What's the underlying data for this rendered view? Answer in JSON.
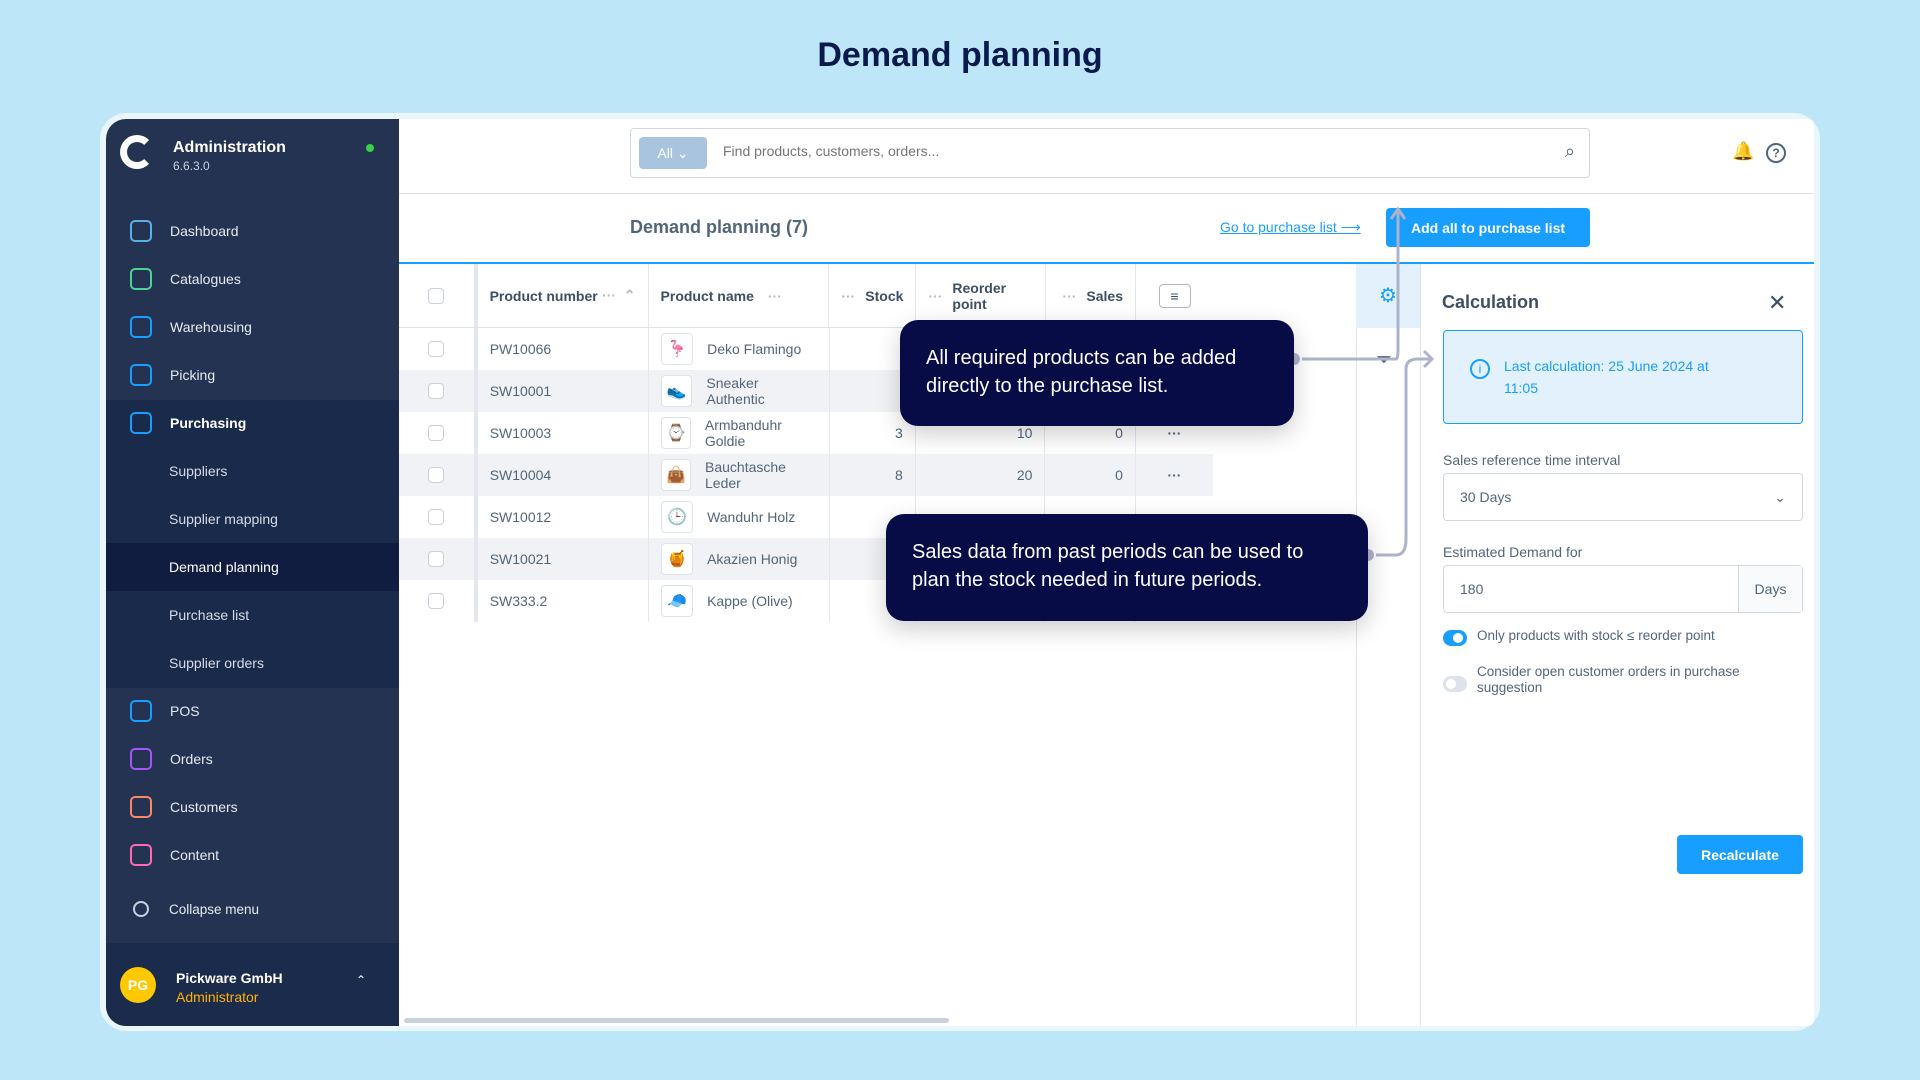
{
  "page_title": "Demand planning",
  "sidebar": {
    "app_name": "Administration",
    "version": "6.6.3.0",
    "items": [
      {
        "label": "Dashboard",
        "icon": "dashboard-icon",
        "color": "#57b0e6"
      },
      {
        "label": "Catalogues",
        "icon": "catalogues-icon",
        "color": "#4bd394"
      },
      {
        "label": "Warehousing",
        "icon": "warehouse-icon",
        "color": "#189eff"
      },
      {
        "label": "Picking",
        "icon": "picking-icon",
        "color": "#189eff"
      },
      {
        "label": "Purchasing",
        "icon": "truck-icon",
        "color": "#189eff"
      }
    ],
    "sub_items": [
      "Suppliers",
      "Supplier mapping",
      "Demand planning",
      "Purchase list",
      "Supplier orders"
    ],
    "items2": [
      {
        "label": "POS",
        "icon": "pos-icon",
        "color": "#189eff"
      },
      {
        "label": "Orders",
        "icon": "orders-icon",
        "color": "#a555f7"
      },
      {
        "label": "Customers",
        "icon": "customers-icon",
        "color": "#f88962"
      },
      {
        "label": "Content",
        "icon": "content-icon",
        "color": "#ff68b4"
      }
    ],
    "collapse": "Collapse menu",
    "user": {
      "initials": "PG",
      "name": "Pickware GmbH",
      "role": "Administrator"
    }
  },
  "search": {
    "scope": "All",
    "placeholder": "Find products, customers, orders..."
  },
  "header": {
    "title": "Demand planning (7)",
    "link": "Go to purchase list",
    "button": "Add all to purchase list"
  },
  "table": {
    "columns": [
      "Product number",
      "Product name",
      "Stock",
      "Reorder point",
      "Sales"
    ],
    "rows": [
      {
        "number": "PW10066",
        "name": "Deko Flamingo",
        "thumb": "🦩",
        "stock": "",
        "reorder": "",
        "sales": ""
      },
      {
        "number": "SW10001",
        "name": "Sneaker Authentic",
        "thumb": "👟",
        "stock": "",
        "reorder": "",
        "sales": ""
      },
      {
        "number": "SW10003",
        "name": "Armbanduhr Goldie",
        "thumb": "⌚",
        "stock": "3",
        "reorder": "10",
        "sales": "0"
      },
      {
        "number": "SW10004",
        "name": "Bauchtasche Leder",
        "thumb": "👜",
        "stock": "8",
        "reorder": "20",
        "sales": "0"
      },
      {
        "number": "SW10012",
        "name": "Wanduhr Holz",
        "thumb": "🕒",
        "stock": "",
        "reorder": "",
        "sales": ""
      },
      {
        "number": "SW10021",
        "name": "Akazien Honig",
        "thumb": "🍯",
        "stock": "",
        "reorder": "",
        "sales": ""
      },
      {
        "number": "SW333.2",
        "name": "Kappe (Olive)",
        "thumb": "🧢",
        "stock": "",
        "reorder": "",
        "sales": ""
      }
    ]
  },
  "tooltips": [
    "All required products can be added directly to the purchase list.",
    "Sales data from past periods can be used to plan the stock needed in future periods."
  ],
  "panel": {
    "title": "Calculation",
    "info": "Last calculation: 25 June 2024 at 11:05",
    "interval_label": "Sales reference time interval",
    "interval_value": "30 Days",
    "demand_label": "Estimated Demand for",
    "demand_value": "180",
    "demand_unit": "Days",
    "toggle1": {
      "label": "Only products with stock ≤ reorder point",
      "on": true
    },
    "toggle2": {
      "label": "Consider open customer orders in purchase suggestion",
      "on": false
    },
    "button": "Recalculate"
  },
  "colors": {
    "accent": "#189eff",
    "sidebar": "#243352",
    "tooltip": "#070c47"
  }
}
